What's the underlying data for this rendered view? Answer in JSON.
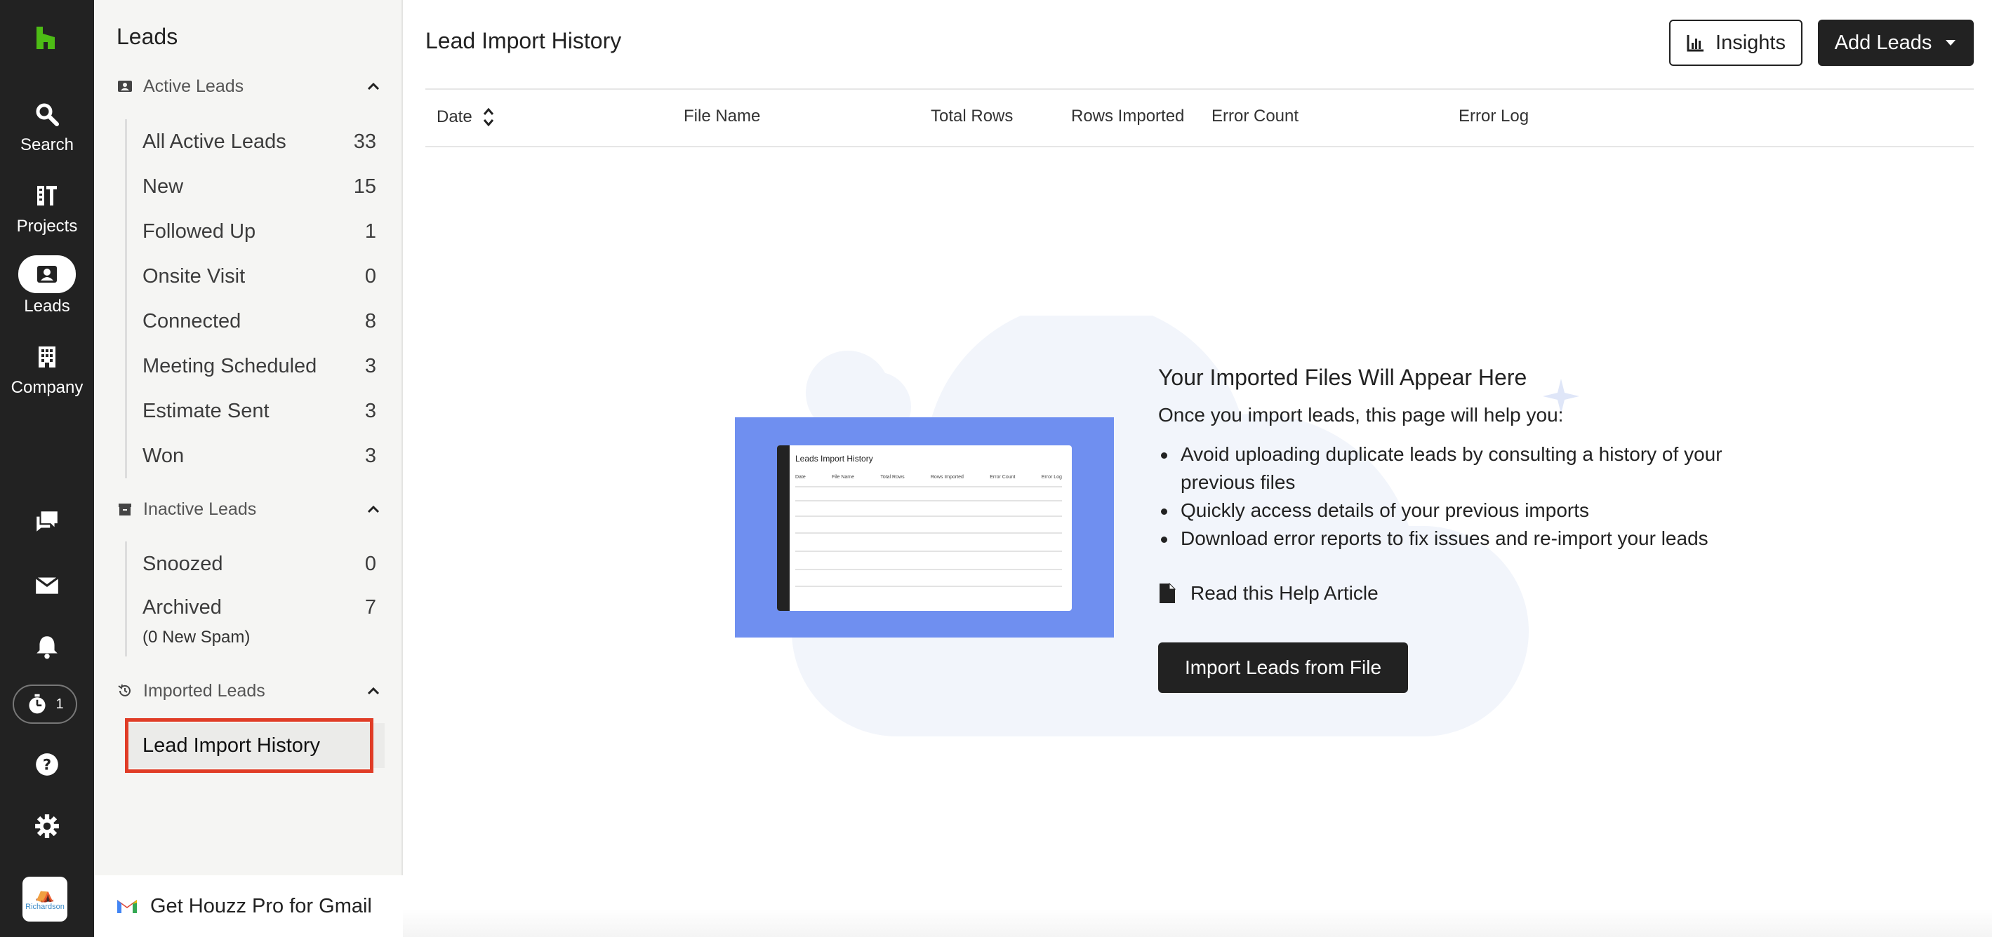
{
  "rail": {
    "items": [
      {
        "label": "Search",
        "icon": "search-icon"
      },
      {
        "label": "Projects",
        "icon": "projects-icon"
      },
      {
        "label": "Leads",
        "icon": "leads-icon"
      },
      {
        "label": "Company",
        "icon": "company-icon"
      }
    ],
    "timer_count": "1",
    "avatar_text": "Richardson"
  },
  "sidebar": {
    "title": "Leads",
    "active": {
      "label": "Active Leads",
      "items": [
        {
          "label": "All Active Leads",
          "count": "33"
        },
        {
          "label": "New",
          "count": "15"
        },
        {
          "label": "Followed Up",
          "count": "1"
        },
        {
          "label": "Onsite Visit",
          "count": "0"
        },
        {
          "label": "Connected",
          "count": "8"
        },
        {
          "label": "Meeting Scheduled",
          "count": "3"
        },
        {
          "label": "Estimate Sent",
          "count": "3"
        },
        {
          "label": "Won",
          "count": "3"
        }
      ]
    },
    "inactive": {
      "label": "Inactive Leads",
      "items": [
        {
          "label": "Snoozed",
          "count": "0"
        },
        {
          "label": "Archived",
          "count": "7",
          "sub": "(0 New Spam)"
        }
      ]
    },
    "imported": {
      "label": "Imported Leads",
      "items": [
        {
          "label": "Lead Import History"
        }
      ]
    },
    "gmail_cta": "Get Houzz Pro for Gmail"
  },
  "main": {
    "title": "Lead Import History",
    "insights_label": "Insights",
    "add_leads_label": "Add Leads",
    "columns": [
      "Date",
      "File Name",
      "Total Rows",
      "Rows Imported",
      "Error Count",
      "Error Log"
    ],
    "empty_state": {
      "title": "Your Imported Files Will Appear Here",
      "intro": "Once you import leads, this page will help you:",
      "bullets": [
        "Avoid uploading duplicate leads by consulting a history of your previous files",
        "Quickly access details of your previous imports",
        "Download error reports to fix issues and re-import your leads"
      ],
      "help_link": "Read this Help Article",
      "import_button": "Import Leads from File",
      "illustration": {
        "title": "Leads Import History",
        "columns": [
          "Date",
          "File Name",
          "Total Rows",
          "Rows Imported",
          "Error Count",
          "Error Log"
        ]
      }
    }
  },
  "colors": {
    "rail_bg": "#222222",
    "brand_green": "#4dbc15",
    "highlight_red": "#e03c26",
    "illustration_blue": "#6f8ff0"
  }
}
